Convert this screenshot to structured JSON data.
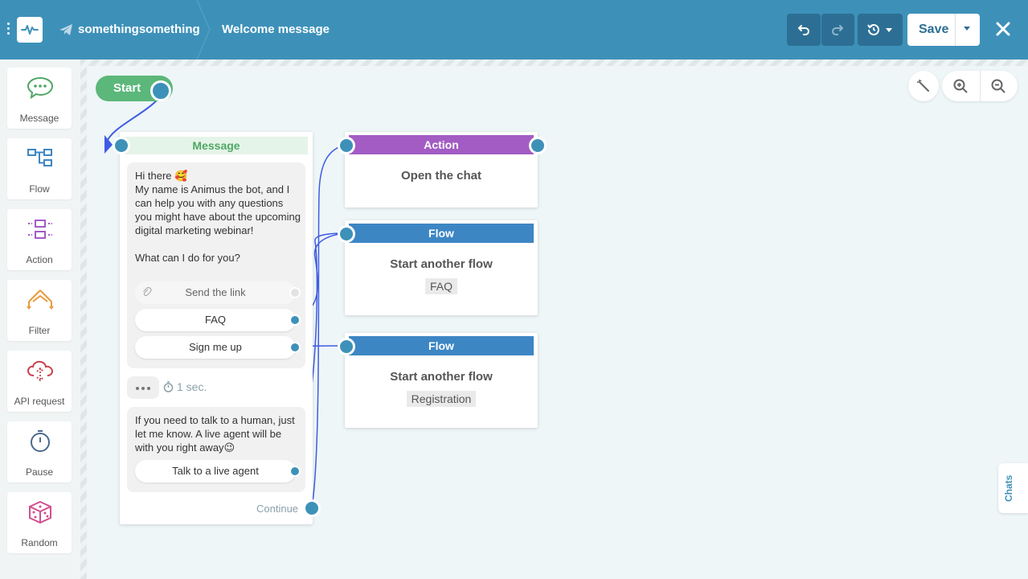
{
  "header": {
    "bot_name": "somethingsomething",
    "flow_title": "Welcome message",
    "save_label": "Save"
  },
  "sidebar": {
    "items": [
      {
        "label": "Message",
        "icon": "chat-bubble-icon"
      },
      {
        "label": "Flow",
        "icon": "flow-icon"
      },
      {
        "label": "Action",
        "icon": "action-icon"
      },
      {
        "label": "Filter",
        "icon": "filter-icon"
      },
      {
        "label": "API request",
        "icon": "cloud-icon"
      },
      {
        "label": "Pause",
        "icon": "timer-icon"
      },
      {
        "label": "Random",
        "icon": "dice-icon"
      }
    ]
  },
  "start": {
    "label": "Start"
  },
  "message_node": {
    "header": "Message",
    "bubble1_text": "Hi there 🥰\nMy name is Animus the bot, and I can help you with any questions you might have about the upcoming digital marketing webinar!\n\nWhat can I do for you?",
    "buttons": [
      "Send the link",
      "FAQ",
      "Sign me up"
    ],
    "delay": "1 sec.",
    "bubble2_text": "If you need to talk to a human, just let me know. A live agent will be with you right away😉",
    "bubble2_button": "Talk to a live agent",
    "continue_label": "Continue"
  },
  "action_node": {
    "header": "Action",
    "title": "Open the chat"
  },
  "flow_node_1": {
    "header": "Flow",
    "title": "Start another flow",
    "tag": "FAQ"
  },
  "flow_node_2": {
    "header": "Flow",
    "title": "Start another flow",
    "tag": "Registration"
  },
  "chats_tab": {
    "label": "Chats"
  },
  "colors": {
    "header_bg": "#3d91b9",
    "action_header": "#a35cc4",
    "flow_header": "#3d86c4",
    "message_header": "#4fa765",
    "start_pill": "#5cb77a",
    "wire": "#3f5be3"
  }
}
